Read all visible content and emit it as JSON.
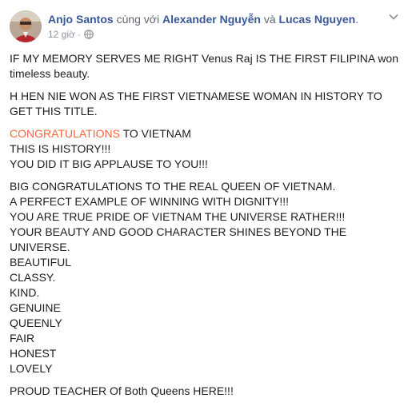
{
  "post": {
    "author": "Anjo Santos",
    "with_text": "cùng với",
    "tagged_1": "Alexander Nguyễn",
    "and_text": "và",
    "tagged_2": "Lucas Nguyen",
    "period": ".",
    "time": "12 giờ",
    "separator": "·",
    "privacy_icon": "globe-icon",
    "more_icon": "chevron-down-icon",
    "paragraphs": [
      [
        "IF MY MEMORY SERVES ME RIGHT Venus Raj IS THE FIRST FILIPINA won timeless beauty."
      ],
      [
        "H HEN NIE WON AS THE FIRST VIETNAMESE WOMAN IN HISTORY TO GET THIS TITLE."
      ],
      [
        "TO VIETNAM",
        "THIS IS HISTORY!!!",
        "YOU DID IT BIG APPLAUSE TO YOU!!!"
      ],
      [
        "BIG CONGRATULATIONS TO THE REAL QUEEN OF VIETNAM.",
        "A PERFECT EXAMPLE OF WINNING WITH DIGNITY!!!",
        "YOU ARE TRUE PRIDE OF VIETNAM THE UNIVERSE RATHER!!!",
        "YOUR BEAUTY AND GOOD CHARACTER SHINES BEYOND THE UNIVERSE.",
        "BEAUTIFUL",
        "CLASSY.",
        "KIND.",
        "GENUINE",
        "QUEENLY",
        "FAIR",
        "HONEST",
        "LOVELY"
      ],
      [
        "PROUD TEACHER Of Both Queens HERE!!!"
      ]
    ],
    "highlight_word": "CONGRATULATIONS"
  },
  "colors": {
    "link": "#385898",
    "text": "#1c1e21",
    "meta": "#90949c",
    "highlight": "#f7653b"
  }
}
